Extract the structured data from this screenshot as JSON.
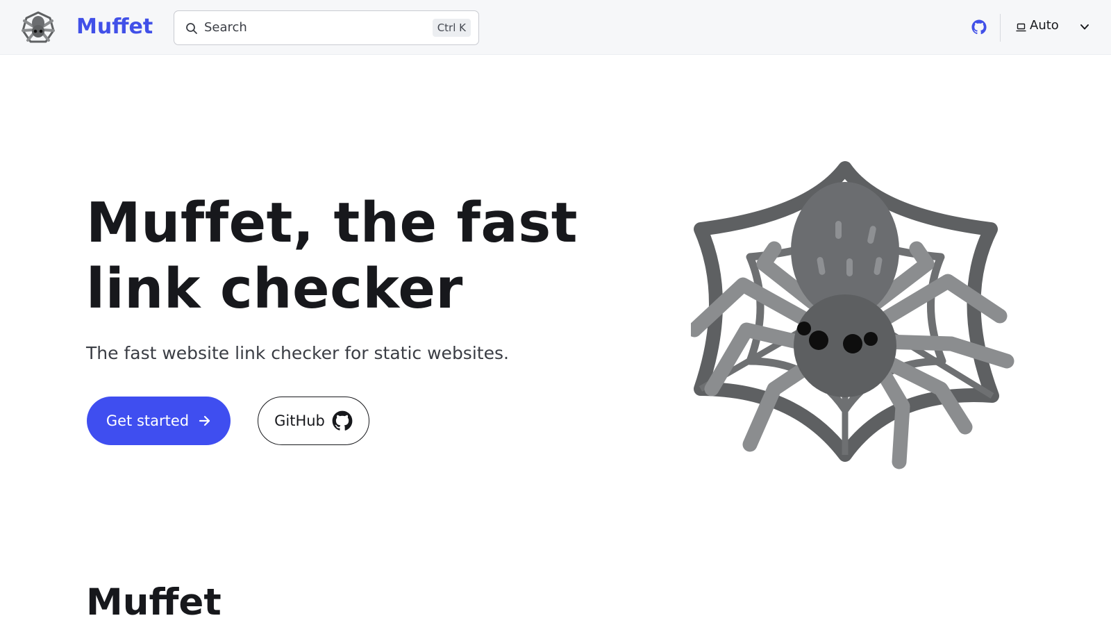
{
  "header": {
    "site_title": "Muffet",
    "search": {
      "placeholder": "Search",
      "shortcut": "Ctrl K"
    },
    "theme_select": {
      "selected": "Auto"
    },
    "icons": [
      "spider-logo-icon",
      "search-icon",
      "github-icon",
      "laptop-icon",
      "chevron-down-icon"
    ]
  },
  "hero": {
    "title": "Muffet, the fast link checker",
    "tagline": "The fast website link checker for static websites.",
    "primary_action": {
      "label": "Get started",
      "icon": "arrow-right-icon"
    },
    "secondary_action": {
      "label": "GitHub",
      "icon": "github-icon"
    },
    "illustration": "spider-on-web-illustration"
  },
  "content": {
    "section_title": "Muffet"
  },
  "colors": {
    "accent": "#3f4ef0",
    "brand_text": "#4150e8",
    "header_bg": "#f6f7f9",
    "text": "#17181c"
  }
}
